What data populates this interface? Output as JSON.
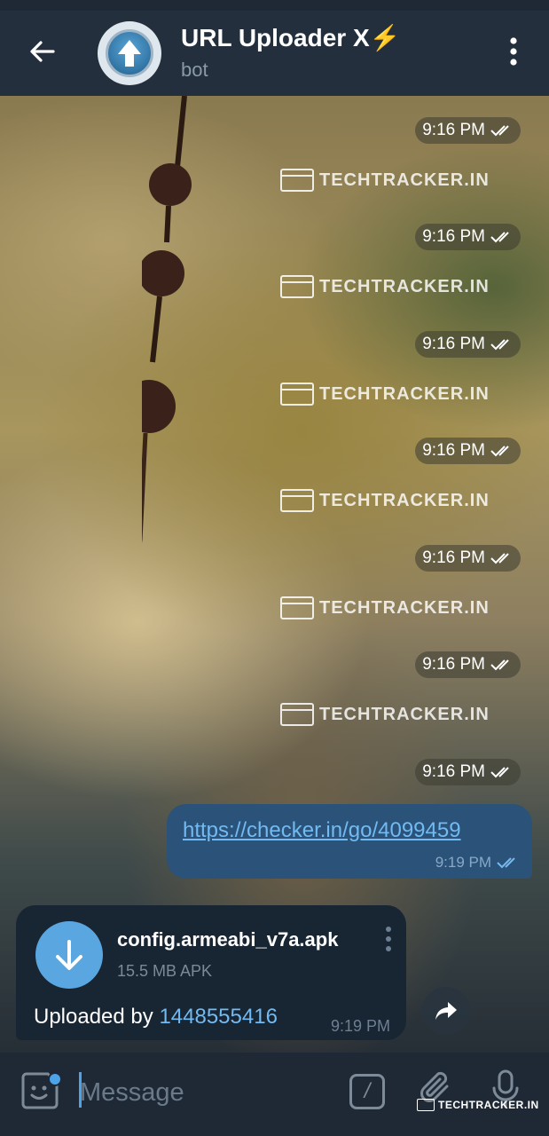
{
  "header": {
    "title": "URL Uploader X⚡",
    "subtitle": "bot",
    "back_icon": "arrow-left-icon",
    "menu_icon": "more-vertical-icon"
  },
  "chat": {
    "service_times": [
      "9:16 PM",
      "9:16 PM",
      "9:16 PM",
      "9:16 PM",
      "9:16 PM",
      "9:16 PM",
      "9:16 PM"
    ],
    "watermark": "TECHTRACKER.IN",
    "outgoing": {
      "link": "https://checker.in/go/4099459",
      "time": "9:19 PM"
    },
    "incoming": {
      "file_name": "config.armeabi_v7a.apk",
      "file_meta": "15.5 MB APK",
      "caption_prefix": "Uploaded by ",
      "caption_id": "1448555416",
      "time": "9:19 PM"
    }
  },
  "input": {
    "placeholder": "Message",
    "command_glyph": "/",
    "corner_watermark": "TECHTRACKER.IN"
  },
  "colors": {
    "header_bg": "#242f3d",
    "outgoing_bubble": "#2b5278",
    "incoming_bubble": "#182533",
    "link": "#71baf2",
    "accent": "#4da3e8"
  }
}
